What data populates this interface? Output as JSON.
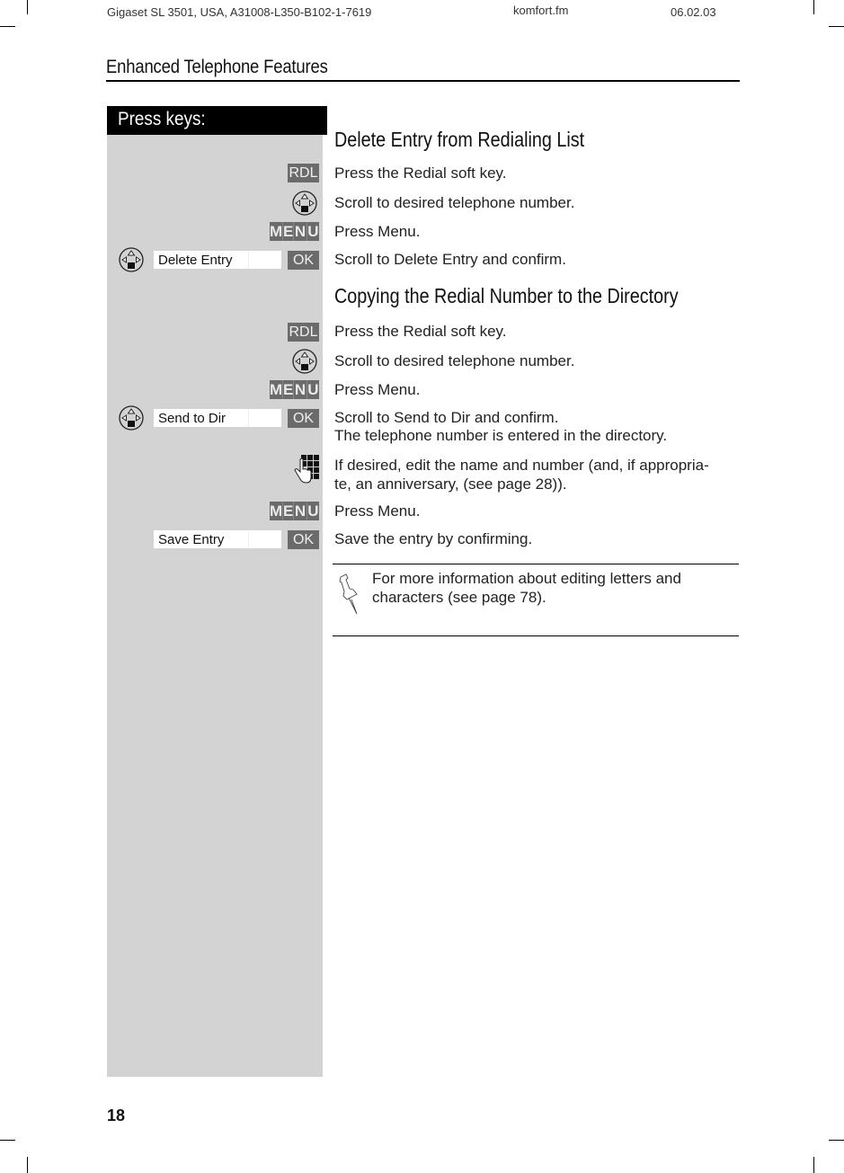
{
  "header": {
    "doc_id": "Gigaset SL 3501, USA, A31008-L350-B102-1-7619",
    "file": "komfort.fm",
    "date": "06.02.03"
  },
  "section_title": "Enhanced Telephone Features",
  "keys_column_header": "Press keys:",
  "sections": [
    {
      "title": "Delete Entry from Redialing List",
      "steps": [
        {
          "key": "RDL",
          "key_type": "softkey",
          "text": "Press the Redial soft key."
        },
        {
          "key": "nav-key",
          "key_type": "icon",
          "text": "Scroll to desired telephone number."
        },
        {
          "key": "MENU",
          "key_type": "menu",
          "text": "Press Menu."
        },
        {
          "key": "nav-key",
          "key_type": "display",
          "display": "Delete Entry",
          "confirm": "OK",
          "text": "Scroll to Delete Entry and confirm."
        }
      ]
    },
    {
      "title": "Copying the Redial Number to the Directory",
      "steps": [
        {
          "key": "RDL",
          "key_type": "softkey",
          "text": "Press the Redial soft key."
        },
        {
          "key": "nav-key",
          "key_type": "icon",
          "text": "Scroll to desired telephone number."
        },
        {
          "key": "MENU",
          "key_type": "menu",
          "text": "Press Menu."
        },
        {
          "key": "nav-key",
          "key_type": "display",
          "display": "Send to Dir",
          "confirm": "OK",
          "text": "Scroll to Send to Dir and confirm.",
          "text2": "The telephone number is entered in the directory."
        },
        {
          "key": "keypad",
          "key_type": "icon",
          "text": "If desired, edit the name and number (and, if appropria-",
          "text2": "te, an anniversary, (see page 28))."
        },
        {
          "key": "MENU",
          "key_type": "menu",
          "text": "Press Menu."
        },
        {
          "key": "none",
          "key_type": "display",
          "display": "Save Entry",
          "confirm": "OK",
          "text": "Save the entry by confirming."
        }
      ]
    }
  ],
  "note": {
    "icon": "pushpin-icon",
    "line1": "For more information about editing letters and",
    "line2": "characters (see page 78)."
  },
  "page_number": "18",
  "colors": {
    "key_column_bg": "#d3d3d3",
    "softkey_bg": "#6b6b6b",
    "header_bg": "#000000"
  }
}
